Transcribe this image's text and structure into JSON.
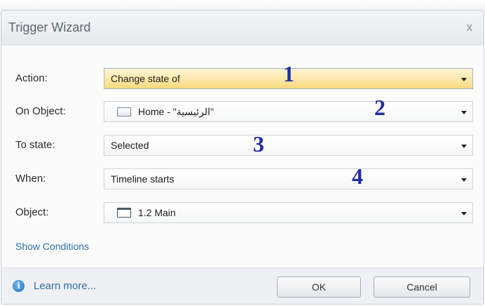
{
  "dialog": {
    "title": "Trigger Wizard",
    "close": "x"
  },
  "rows": {
    "action": {
      "label": "Action:",
      "value": "Change state of",
      "marker": "1"
    },
    "on_object": {
      "label": "On Object:",
      "value": "Home - \"الرئيسية\"",
      "marker": "2",
      "icon": "object-icon"
    },
    "to_state": {
      "label": "To state:",
      "value": "Selected",
      "marker": "3"
    },
    "when": {
      "label": "When:",
      "value": "Timeline starts",
      "marker": "4"
    },
    "object": {
      "label": "Object:",
      "value": "1.2 Main",
      "icon": "window-icon"
    }
  },
  "show_conditions": "Show Conditions",
  "footer": {
    "learn_more": "Learn more...",
    "ok": "OK",
    "cancel": "Cancel",
    "info_icon": "info-icon"
  },
  "colors": {
    "marker": "#1f2fa7",
    "link": "#2e6ea6",
    "active_combo": "#fde6a3"
  }
}
